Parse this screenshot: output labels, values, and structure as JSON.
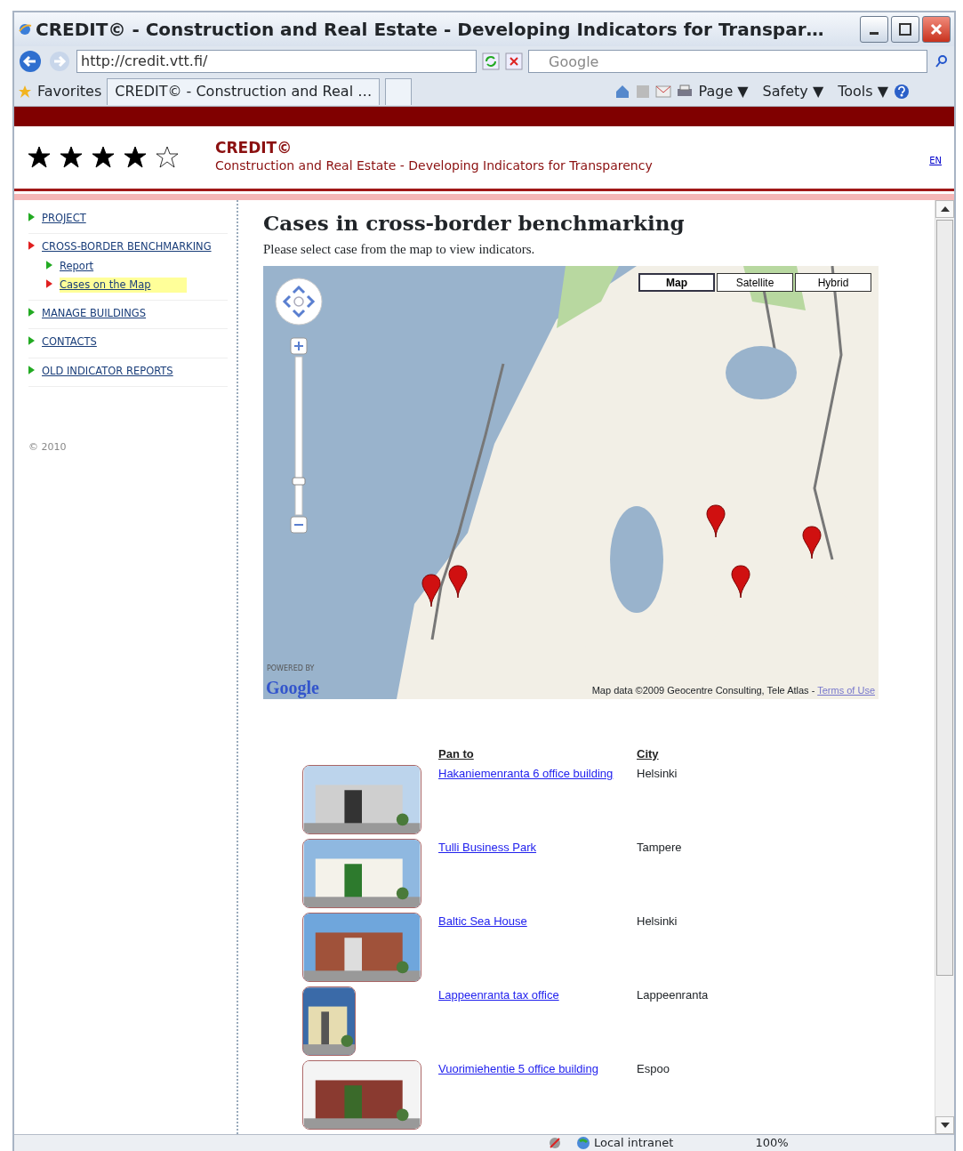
{
  "window": {
    "title": "CREDIT© - Construction and Real Estate - Developing Indicators for Transpar…"
  },
  "toolbar": {
    "address": "http://credit.vtt.fi/",
    "search_placeholder": "Google"
  },
  "favorites": {
    "label": "Favorites",
    "tab": "CREDIT© - Construction and Real …",
    "menus": [
      "Page ▼",
      "Safety ▼",
      "Tools ▼"
    ]
  },
  "site": {
    "stars": 4,
    "title": "CREDIT©",
    "subtitle": "Construction and Real Estate - Developing Indicators for Transparency",
    "language": "EN"
  },
  "sidebar": {
    "items": [
      {
        "label": "PROJECT",
        "selected": false
      },
      {
        "label": "CROSS-BORDER BENCHMARKING",
        "selected": false,
        "children": [
          {
            "label": "Report",
            "selected": false
          },
          {
            "label": "Cases on the Map",
            "selected": true
          }
        ]
      },
      {
        "label": "MANAGE BUILDINGS",
        "selected": false
      },
      {
        "label": "CONTACTS",
        "selected": false
      },
      {
        "label": "OLD INDICATOR REPORTS",
        "selected": false
      }
    ],
    "copyright": "© 2010"
  },
  "content": {
    "heading": "Cases in cross-border benchmarking",
    "intro": "Please select case from the map to view indicators.",
    "map": {
      "kind": "picture",
      "zoom": {
        "level": 0.2
      },
      "types": [
        {
          "label": "Map",
          "selected": true
        },
        {
          "label": "Satellite",
          "selected": false
        },
        {
          "label": "Hybrid",
          "selected": false
        }
      ],
      "powered_by": "POWERED BY",
      "logo": "Google",
      "attribution": "Map data ©2009 Geocentre Consulting, Tele Atlas -",
      "terms": "Terms of Use"
    },
    "table": {
      "columns": [
        "Pan to",
        "City"
      ],
      "rows": [
        {
          "name": "Hakaniemenranta 6 office building",
          "city": "Helsinki",
          "portrait": false
        },
        {
          "name": "Tulli Business Park",
          "city": "Tampere",
          "portrait": false
        },
        {
          "name": "Baltic Sea House",
          "city": "Helsinki",
          "portrait": false
        },
        {
          "name": "Lappeenranta tax office",
          "city": "Lappeenranta",
          "portrait": true
        },
        {
          "name": "Vuorimiehentie 5 office building",
          "city": "Espoo",
          "portrait": false
        }
      ]
    }
  },
  "status_bar": {
    "zone": "Local intranet",
    "zoom": "100%"
  }
}
